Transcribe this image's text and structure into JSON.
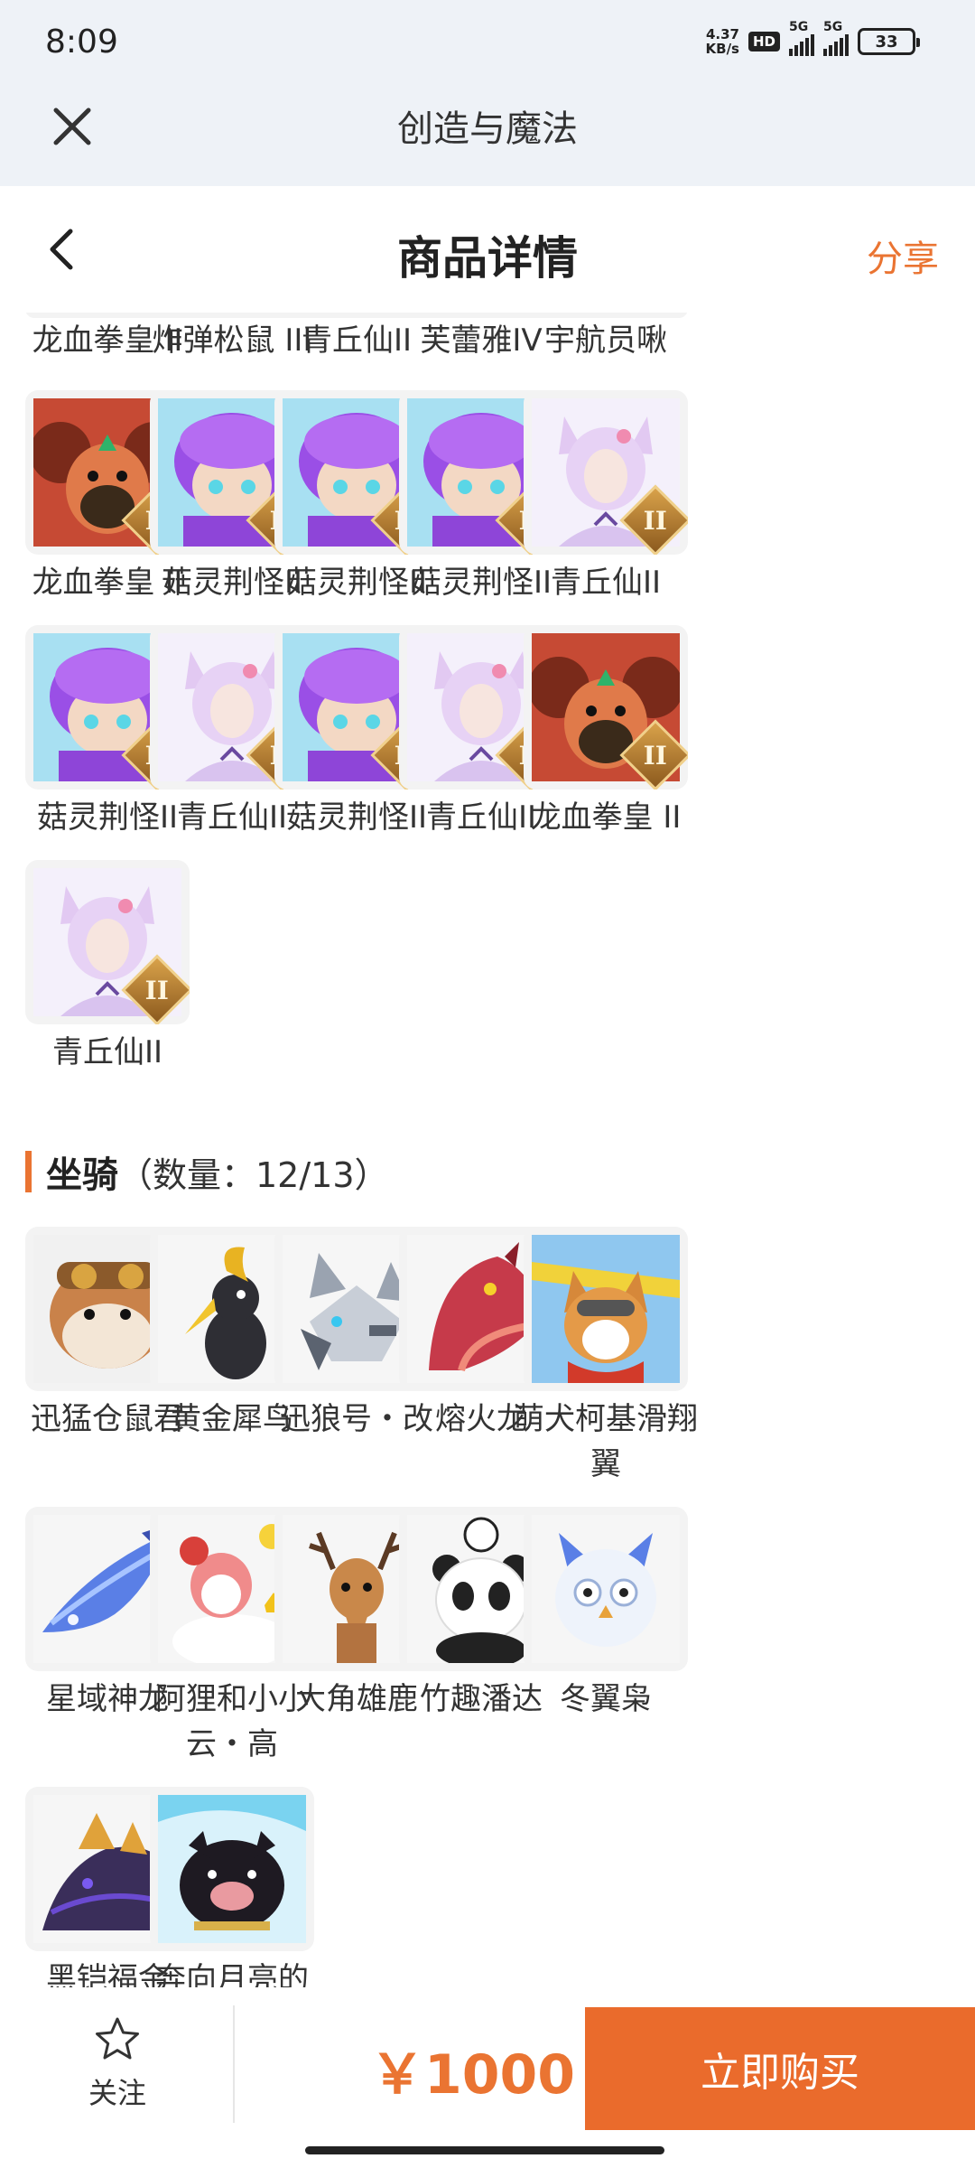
{
  "status_bar": {
    "time": "8:09",
    "net_speed_value": "4.37",
    "net_speed_unit": "KB/s",
    "hd_label": "HD",
    "signal_label_1": "5G",
    "signal_label_2": "5G",
    "battery": "33"
  },
  "web_header": {
    "title": "创造与魔法",
    "close_icon": "close-icon"
  },
  "page_nav": {
    "title": "商品详情",
    "share_label": "分享",
    "back_icon": "chevron-left-icon"
  },
  "pets": {
    "partial_row": [
      "龙血拳皇 II",
      "炸弹松鼠 III",
      "青丘仙II",
      "芙蕾雅IV",
      "宇航员啾"
    ],
    "items": [
      {
        "label": "龙血拳皇 II",
        "art": "dragon",
        "badge": "II"
      },
      {
        "label": "菇灵荆怪II",
        "art": "purple",
        "badge": "II"
      },
      {
        "label": "菇灵荆怪II",
        "art": "purple",
        "badge": "II"
      },
      {
        "label": "菇灵荆怪II",
        "art": "purple",
        "badge": "II"
      },
      {
        "label": "青丘仙II",
        "art": "fox",
        "badge": "II"
      },
      {
        "label": "菇灵荆怪II",
        "art": "purple",
        "badge": "II"
      },
      {
        "label": "青丘仙II",
        "art": "fox",
        "badge": "II"
      },
      {
        "label": "菇灵荆怪II",
        "art": "purple",
        "badge": "II"
      },
      {
        "label": "青丘仙II",
        "art": "fox",
        "badge": "II"
      },
      {
        "label": "龙血拳皇 II",
        "art": "dragon",
        "badge": "II"
      },
      {
        "label": "青丘仙II",
        "art": "fox",
        "badge": "II"
      }
    ]
  },
  "mounts": {
    "title": "坐骑",
    "count": "（数量：12/13）",
    "items": [
      {
        "label": "迅猛仓鼠君",
        "art": "hamster"
      },
      {
        "label": "黄金犀鸟",
        "art": "hornbill"
      },
      {
        "label": "迅狼号・改",
        "art": "robowolf"
      },
      {
        "label": "熔火龙",
        "art": "reddragon"
      },
      {
        "label": "萌犬柯基滑翔翼",
        "art": "corgi"
      },
      {
        "label": "星域神龙",
        "art": "bluedragon"
      },
      {
        "label": "阿狸和小小云・高",
        "art": "ali"
      },
      {
        "label": "大角雄鹿",
        "art": "deer"
      },
      {
        "label": "竹趣潘达",
        "art": "panda"
      },
      {
        "label": "冬翼枭",
        "art": "owl"
      },
      {
        "label": "黑铠福金",
        "art": "blackdragon"
      },
      {
        "label": "奔向月亮的",
        "art": "pig"
      }
    ]
  },
  "bottom_bar": {
    "follow_label": "关注",
    "price": "￥1000",
    "buy_label": "立即购买"
  },
  "colors": {
    "accent": "#ea7432",
    "buy_button": "#ea6b2c",
    "header_bg": "#eef2f7"
  }
}
